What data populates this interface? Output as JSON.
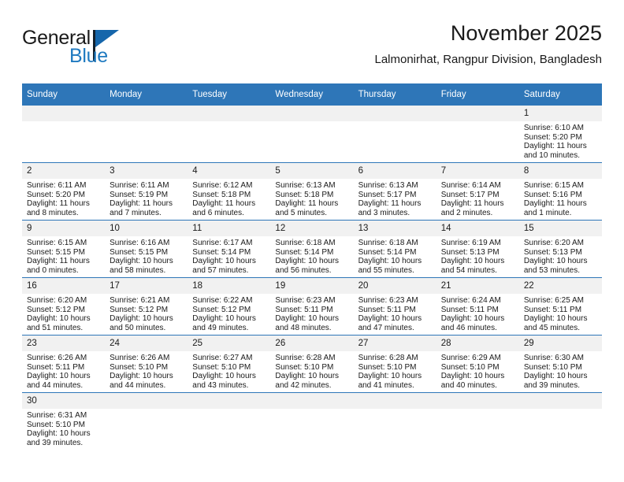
{
  "logo": {
    "word1": "General",
    "word2": "Blue",
    "accent_color": "#1f7ac0",
    "flag_color": "#1566ab"
  },
  "header": {
    "title": "November 2025",
    "subtitle": "Lalmonirhat, Rangpur Division, Bangladesh"
  },
  "theme": {
    "header_bg": "#2e76b8",
    "daynum_bg": "#f1f1f1",
    "text": "#1a1a1a"
  },
  "weekdays": [
    "Sunday",
    "Monday",
    "Tuesday",
    "Wednesday",
    "Thursday",
    "Friday",
    "Saturday"
  ],
  "weeks": [
    [
      {
        "day": "",
        "lines": []
      },
      {
        "day": "",
        "lines": []
      },
      {
        "day": "",
        "lines": []
      },
      {
        "day": "",
        "lines": []
      },
      {
        "day": "",
        "lines": []
      },
      {
        "day": "",
        "lines": []
      },
      {
        "day": "1",
        "lines": [
          "Sunrise: 6:10 AM",
          "Sunset: 5:20 PM",
          "Daylight: 11 hours",
          "and 10 minutes."
        ]
      }
    ],
    [
      {
        "day": "2",
        "lines": [
          "Sunrise: 6:11 AM",
          "Sunset: 5:20 PM",
          "Daylight: 11 hours",
          "and 8 minutes."
        ]
      },
      {
        "day": "3",
        "lines": [
          "Sunrise: 6:11 AM",
          "Sunset: 5:19 PM",
          "Daylight: 11 hours",
          "and 7 minutes."
        ]
      },
      {
        "day": "4",
        "lines": [
          "Sunrise: 6:12 AM",
          "Sunset: 5:18 PM",
          "Daylight: 11 hours",
          "and 6 minutes."
        ]
      },
      {
        "day": "5",
        "lines": [
          "Sunrise: 6:13 AM",
          "Sunset: 5:18 PM",
          "Daylight: 11 hours",
          "and 5 minutes."
        ]
      },
      {
        "day": "6",
        "lines": [
          "Sunrise: 6:13 AM",
          "Sunset: 5:17 PM",
          "Daylight: 11 hours",
          "and 3 minutes."
        ]
      },
      {
        "day": "7",
        "lines": [
          "Sunrise: 6:14 AM",
          "Sunset: 5:17 PM",
          "Daylight: 11 hours",
          "and 2 minutes."
        ]
      },
      {
        "day": "8",
        "lines": [
          "Sunrise: 6:15 AM",
          "Sunset: 5:16 PM",
          "Daylight: 11 hours",
          "and 1 minute."
        ]
      }
    ],
    [
      {
        "day": "9",
        "lines": [
          "Sunrise: 6:15 AM",
          "Sunset: 5:15 PM",
          "Daylight: 11 hours",
          "and 0 minutes."
        ]
      },
      {
        "day": "10",
        "lines": [
          "Sunrise: 6:16 AM",
          "Sunset: 5:15 PM",
          "Daylight: 10 hours",
          "and 58 minutes."
        ]
      },
      {
        "day": "11",
        "lines": [
          "Sunrise: 6:17 AM",
          "Sunset: 5:14 PM",
          "Daylight: 10 hours",
          "and 57 minutes."
        ]
      },
      {
        "day": "12",
        "lines": [
          "Sunrise: 6:18 AM",
          "Sunset: 5:14 PM",
          "Daylight: 10 hours",
          "and 56 minutes."
        ]
      },
      {
        "day": "13",
        "lines": [
          "Sunrise: 6:18 AM",
          "Sunset: 5:14 PM",
          "Daylight: 10 hours",
          "and 55 minutes."
        ]
      },
      {
        "day": "14",
        "lines": [
          "Sunrise: 6:19 AM",
          "Sunset: 5:13 PM",
          "Daylight: 10 hours",
          "and 54 minutes."
        ]
      },
      {
        "day": "15",
        "lines": [
          "Sunrise: 6:20 AM",
          "Sunset: 5:13 PM",
          "Daylight: 10 hours",
          "and 53 minutes."
        ]
      }
    ],
    [
      {
        "day": "16",
        "lines": [
          "Sunrise: 6:20 AM",
          "Sunset: 5:12 PM",
          "Daylight: 10 hours",
          "and 51 minutes."
        ]
      },
      {
        "day": "17",
        "lines": [
          "Sunrise: 6:21 AM",
          "Sunset: 5:12 PM",
          "Daylight: 10 hours",
          "and 50 minutes."
        ]
      },
      {
        "day": "18",
        "lines": [
          "Sunrise: 6:22 AM",
          "Sunset: 5:12 PM",
          "Daylight: 10 hours",
          "and 49 minutes."
        ]
      },
      {
        "day": "19",
        "lines": [
          "Sunrise: 6:23 AM",
          "Sunset: 5:11 PM",
          "Daylight: 10 hours",
          "and 48 minutes."
        ]
      },
      {
        "day": "20",
        "lines": [
          "Sunrise: 6:23 AM",
          "Sunset: 5:11 PM",
          "Daylight: 10 hours",
          "and 47 minutes."
        ]
      },
      {
        "day": "21",
        "lines": [
          "Sunrise: 6:24 AM",
          "Sunset: 5:11 PM",
          "Daylight: 10 hours",
          "and 46 minutes."
        ]
      },
      {
        "day": "22",
        "lines": [
          "Sunrise: 6:25 AM",
          "Sunset: 5:11 PM",
          "Daylight: 10 hours",
          "and 45 minutes."
        ]
      }
    ],
    [
      {
        "day": "23",
        "lines": [
          "Sunrise: 6:26 AM",
          "Sunset: 5:11 PM",
          "Daylight: 10 hours",
          "and 44 minutes."
        ]
      },
      {
        "day": "24",
        "lines": [
          "Sunrise: 6:26 AM",
          "Sunset: 5:10 PM",
          "Daylight: 10 hours",
          "and 44 minutes."
        ]
      },
      {
        "day": "25",
        "lines": [
          "Sunrise: 6:27 AM",
          "Sunset: 5:10 PM",
          "Daylight: 10 hours",
          "and 43 minutes."
        ]
      },
      {
        "day": "26",
        "lines": [
          "Sunrise: 6:28 AM",
          "Sunset: 5:10 PM",
          "Daylight: 10 hours",
          "and 42 minutes."
        ]
      },
      {
        "day": "27",
        "lines": [
          "Sunrise: 6:28 AM",
          "Sunset: 5:10 PM",
          "Daylight: 10 hours",
          "and 41 minutes."
        ]
      },
      {
        "day": "28",
        "lines": [
          "Sunrise: 6:29 AM",
          "Sunset: 5:10 PM",
          "Daylight: 10 hours",
          "and 40 minutes."
        ]
      },
      {
        "day": "29",
        "lines": [
          "Sunrise: 6:30 AM",
          "Sunset: 5:10 PM",
          "Daylight: 10 hours",
          "and 39 minutes."
        ]
      }
    ],
    [
      {
        "day": "30",
        "lines": [
          "Sunrise: 6:31 AM",
          "Sunset: 5:10 PM",
          "Daylight: 10 hours",
          "and 39 minutes."
        ]
      },
      {
        "day": "",
        "lines": []
      },
      {
        "day": "",
        "lines": []
      },
      {
        "day": "",
        "lines": []
      },
      {
        "day": "",
        "lines": []
      },
      {
        "day": "",
        "lines": []
      },
      {
        "day": "",
        "lines": []
      }
    ]
  ]
}
